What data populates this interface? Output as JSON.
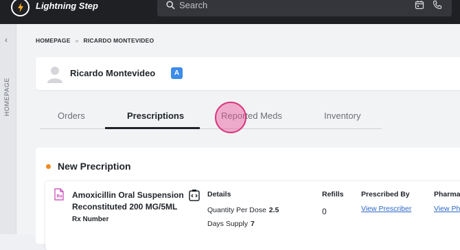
{
  "app": {
    "title": "Lightning Step",
    "accent": "#f5a623"
  },
  "search": {
    "placeholder": "Search"
  },
  "topbar_icons": [
    "calendar-icon",
    "phone-icon"
  ],
  "siderail": {
    "label": "HOMEPAGE"
  },
  "breadcrumb": {
    "home": "HOMEPAGE",
    "separator": "»",
    "current": "RICARDO MONTEVIDEO"
  },
  "patient": {
    "name": "Ricardo Montevideo",
    "badge": "A"
  },
  "tabs": [
    {
      "label": "Orders",
      "active": false
    },
    {
      "label": "Prescriptions",
      "active": true
    },
    {
      "label": "Reported Meds",
      "active": false
    },
    {
      "label": "Inventory",
      "active": false
    }
  ],
  "section": {
    "title": "New Precription",
    "dot_color": "#f08a1d"
  },
  "prescription": {
    "med_name": "Amoxicillin Oral Suspension Reconstituted 200 MG/5ML",
    "rx_number_label": "Rx Number",
    "details_label": "Details",
    "quantity_label": "Quantity Per Dose",
    "quantity_value": "2.5",
    "days_label": "Days Supply",
    "days_value": "7",
    "refills_label": "Refills",
    "refills_value": "0",
    "prescribed_by_label": "Prescribed By",
    "prescribed_by_link": "View Prescriber",
    "pharmacy_label": "Pharma",
    "pharmacy_link": "View Ph"
  }
}
